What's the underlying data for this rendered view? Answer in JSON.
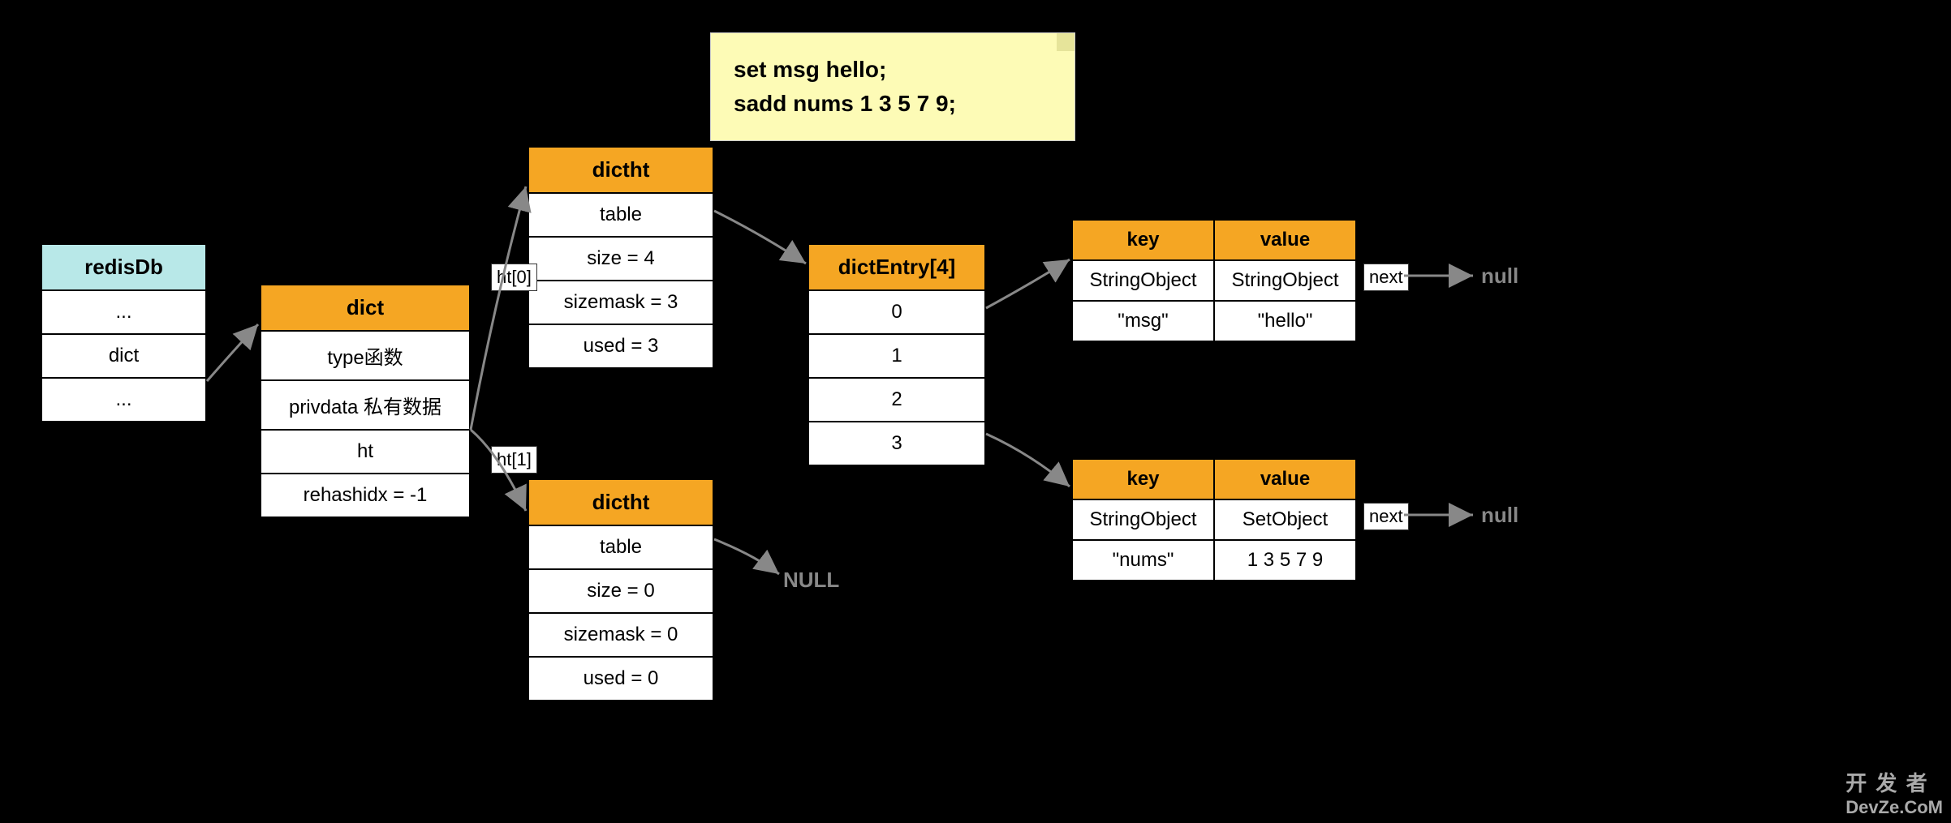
{
  "sticky": {
    "line1": "set msg hello;",
    "line2": "sadd nums 1 3 5 7 9;"
  },
  "redisDb": {
    "title": "redisDb",
    "rows": [
      "...",
      "dict",
      "..."
    ]
  },
  "dict": {
    "title": "dict",
    "rows": [
      "type函数",
      "privdata 私有数据",
      "ht",
      "rehashidx = -1"
    ]
  },
  "dictht0": {
    "title": "dictht",
    "rows": [
      "table",
      "size = 4",
      "sizemask = 3",
      "used = 3"
    ]
  },
  "dictht1": {
    "title": "dictht",
    "rows": [
      "table",
      "size = 0",
      "sizemask = 0",
      "used = 0"
    ]
  },
  "dictEntryArr": {
    "title": "dictEntry[4]",
    "rows": [
      "0",
      "1",
      "2",
      "3"
    ]
  },
  "entry1": {
    "keyHeader": "key",
    "valueHeader": "value",
    "keyType": "StringObject",
    "valueType": "StringObject",
    "keyVal": "\"msg\"",
    "valueVal": "\"hello\""
  },
  "entry2": {
    "keyHeader": "key",
    "valueHeader": "value",
    "keyType": "StringObject",
    "valueType": "SetObject",
    "keyVal": "\"nums\"",
    "valueVal": "1 3 5 7 9"
  },
  "labels": {
    "ht0": "ht[0]",
    "ht1": "ht[1]",
    "next1": "next",
    "next2": "next",
    "null1": "null",
    "null2": "null",
    "nullBig": "NULL"
  },
  "watermark": {
    "top": "开 发 者",
    "bottom": "DevZe.CoM"
  },
  "chart_data": {
    "type": "diagram",
    "description": "Redis database structure diagram",
    "commands": [
      "set msg hello;",
      "sadd nums 1 3 5 7 9;"
    ],
    "structures": {
      "redisDb": {
        "fields": [
          "...",
          "dict",
          "..."
        ]
      },
      "dict": {
        "type": "type函数",
        "privdata": "私有数据",
        "ht": [
          "ht[0]",
          "ht[1]"
        ],
        "rehashidx": -1
      },
      "ht[0]": {
        "struct": "dictht",
        "table": "dictEntry[4]",
        "size": 4,
        "sizemask": 3,
        "used": 3
      },
      "ht[1]": {
        "struct": "dictht",
        "table": "NULL",
        "size": 0,
        "sizemask": 0,
        "used": 0
      },
      "dictEntry[4]": {
        "0": {
          "key": {
            "type": "StringObject",
            "value": "msg"
          },
          "value": {
            "type": "StringObject",
            "value": "hello"
          },
          "next": "null"
        },
        "1": null,
        "2": null,
        "3": {
          "key": {
            "type": "StringObject",
            "value": "nums"
          },
          "value": {
            "type": "SetObject",
            "value": "1 3 5 7 9"
          },
          "next": "null"
        }
      }
    }
  }
}
